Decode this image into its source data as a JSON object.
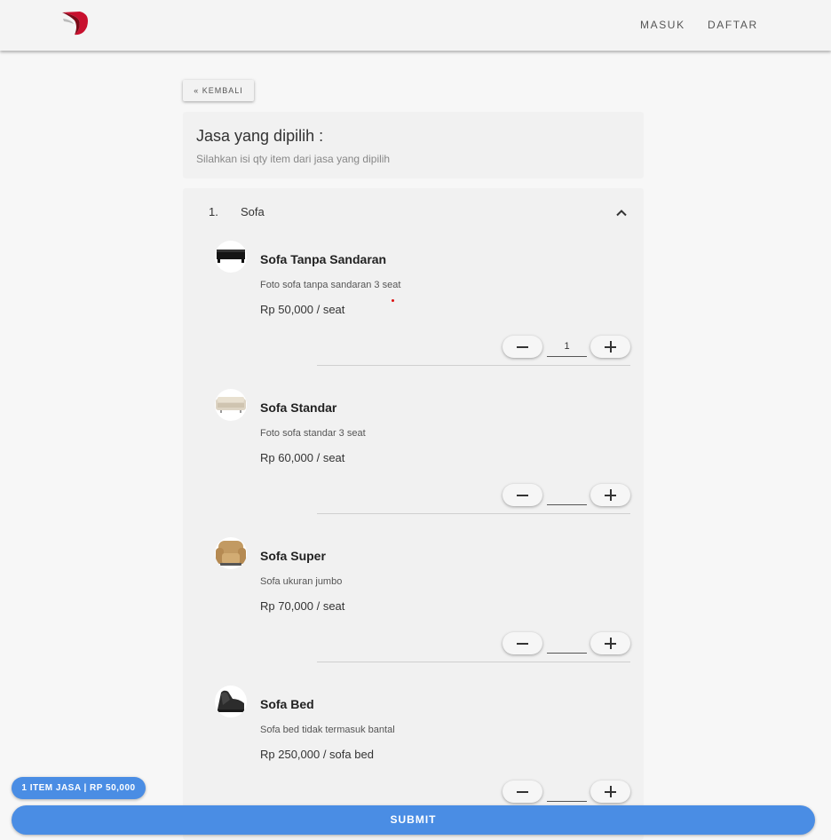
{
  "nav": {
    "logo_icon": "brand-logo-icon",
    "login_label": "MASUK",
    "register_label": "DAFTAR"
  },
  "back_label": "« KEMBALI",
  "header": {
    "title": "Jasa yang dipilih :",
    "subtitle": "Silahkan isi qty item dari jasa yang dipilih"
  },
  "section": {
    "number": "1.",
    "name": "Sofa",
    "toggle_icon": "chevron-up-icon",
    "items": [
      {
        "name": "Sofa Tanpa Sandaran",
        "description": "Foto sofa tanpa sandaran 3 seat",
        "price": "Rp 50,000 / seat",
        "qty": "1"
      },
      {
        "name": "Sofa Standar",
        "description": "Foto sofa standar 3 seat",
        "price": "Rp 60,000 / seat",
        "qty": ""
      },
      {
        "name": "Sofa Super",
        "description": "Sofa ukuran jumbo",
        "price": "Rp 70,000 / seat",
        "qty": ""
      },
      {
        "name": "Sofa Bed",
        "description": "Sofa bed tidak termasuk bantal",
        "price": "Rp 250,000 / sofa bed",
        "qty": ""
      }
    ]
  },
  "summary_label": "1 ITEM JASA | RP 50,000",
  "submit_label": "SUBMIT",
  "colors": {
    "accent": "#4a8de4",
    "brand_red": "#c8102e",
    "background": "#f7f7f7",
    "card": "#f1f1f1"
  }
}
